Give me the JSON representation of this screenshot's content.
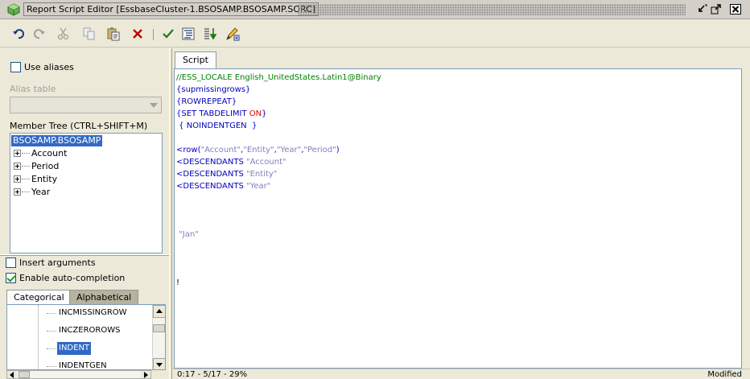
{
  "window": {
    "title": "Report Script Editor [EssbaseCluster-1.BSOSAMP.BSOSAMP.SORC]"
  },
  "toolbar": {
    "icons": [
      "undo-icon",
      "redo-icon",
      "cut-icon",
      "copy-icon",
      "paste-icon",
      "delete-icon",
      "validate-icon",
      "format-icon",
      "execute-icon",
      "edit-add-icon"
    ]
  },
  "left_panel": {
    "use_aliases_label": "Use aliases",
    "use_aliases_checked": false,
    "alias_table_label": "Alias table",
    "alias_table_value": "",
    "member_tree_label": "Member Tree (CTRL+SHIFT+M)",
    "member_tree": {
      "root": "BSOSAMP.BSOSAMP",
      "children": [
        "Account",
        "Period",
        "Entity",
        "Year"
      ]
    },
    "insert_arguments_label": "Insert arguments",
    "insert_arguments_checked": false,
    "enable_autocompletion_label": "Enable auto-completion",
    "enable_autocompletion_checked": true,
    "tabs": [
      "Categorical",
      "Alphabetical"
    ],
    "active_tab": "Categorical",
    "keywords": [
      "INCMISSINGROW",
      "INCZEROROWS",
      "INDENT",
      "INDENTGEN"
    ],
    "selected_keyword": "INDENT"
  },
  "editor": {
    "tab_label": "Script",
    "lines": [
      [
        {
          "t": "//ESS_LOCALE English_UnitedStates.Latin1@Binary",
          "c": "green"
        }
      ],
      [
        {
          "t": "{supmissingrows}",
          "c": "blue"
        }
      ],
      [
        {
          "t": "{ROWREPEAT}",
          "c": "blue"
        }
      ],
      [
        {
          "t": "{SET TABDELIMIT ",
          "c": "blue"
        },
        {
          "t": "ON",
          "c": "red"
        },
        {
          "t": "}",
          "c": "blue"
        }
      ],
      [
        {
          "t": " { NOINDENTGEN  }",
          "c": "blue"
        }
      ],
      [
        {
          "t": "",
          "c": "black"
        }
      ],
      [
        {
          "t": "<row(",
          "c": "blue"
        },
        {
          "t": "\"Account\"",
          "c": "gray"
        },
        {
          "t": ",",
          "c": "blue"
        },
        {
          "t": "\"Entity\"",
          "c": "gray"
        },
        {
          "t": ",",
          "c": "blue"
        },
        {
          "t": "\"Year\"",
          "c": "gray"
        },
        {
          "t": ",",
          "c": "blue"
        },
        {
          "t": "\"Period\"",
          "c": "gray"
        },
        {
          "t": ")",
          "c": "blue"
        }
      ],
      [
        {
          "t": "<DESCENDANTS ",
          "c": "blue"
        },
        {
          "t": "\"Account\"",
          "c": "gray"
        }
      ],
      [
        {
          "t": "<DESCENDANTS ",
          "c": "blue"
        },
        {
          "t": "\"Entity\"",
          "c": "gray"
        }
      ],
      [
        {
          "t": "<DESCENDANTS ",
          "c": "blue"
        },
        {
          "t": "\"Year\"",
          "c": "gray"
        }
      ],
      [
        {
          "t": "",
          "c": "black"
        }
      ],
      [
        {
          "t": "",
          "c": "black"
        }
      ],
      [
        {
          "t": "",
          "c": "black"
        }
      ],
      [
        {
          "t": " \"Jan\"",
          "c": "gray"
        }
      ],
      [
        {
          "t": "",
          "c": "black"
        }
      ],
      [
        {
          "t": "",
          "c": "black"
        }
      ],
      [
        {
          "t": "",
          "c": "black"
        }
      ],
      [
        {
          "t": "!",
          "c": "black"
        }
      ]
    ],
    "status_position": "0:17 - 5/17 - 29%",
    "status_state": "Modified"
  },
  "colors": {
    "selection": "#316ac5",
    "comment": "#008000",
    "keyword": "#0000c0",
    "string": "#8080c0",
    "constant": "#e00000"
  }
}
